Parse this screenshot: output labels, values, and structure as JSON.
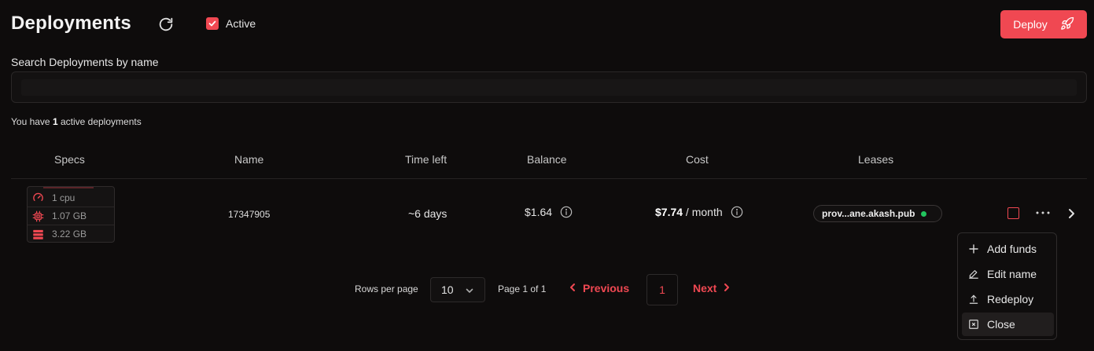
{
  "header": {
    "title": "Deployments",
    "active_filter": {
      "label": "Active",
      "checked": true
    },
    "deploy_button": "Deploy"
  },
  "search": {
    "label": "Search Deployments by name",
    "value": "",
    "placeholder": ""
  },
  "summary": {
    "prefix": "You have ",
    "count": "1",
    "suffix": " active deployments"
  },
  "table": {
    "columns": [
      "Specs",
      "Name",
      "Time left",
      "Balance",
      "Cost",
      "Leases"
    ],
    "rows": [
      {
        "specs": {
          "cpu": "1 cpu",
          "memory": "1.07 GB",
          "storage": "3.22 GB"
        },
        "name": "17347905",
        "time_left": "~6 days",
        "balance": "$1.64",
        "cost_amount": "$7.74",
        "cost_period": " / month",
        "lease": "prov...ane.akash.pub",
        "lease_status_color": "#22c55e"
      }
    ]
  },
  "pagination": {
    "rows_per_page_label": "Rows per page",
    "rows_per_page": "10",
    "page_info": "Page 1 of 1",
    "previous": "Previous",
    "current_page": "1",
    "next": "Next"
  },
  "row_menu": {
    "items": [
      "Add funds",
      "Edit name",
      "Redeploy",
      "Close"
    ]
  },
  "colors": {
    "accent": "#f04852",
    "background": "#0e0c0c",
    "status_ok": "#22c55e"
  }
}
